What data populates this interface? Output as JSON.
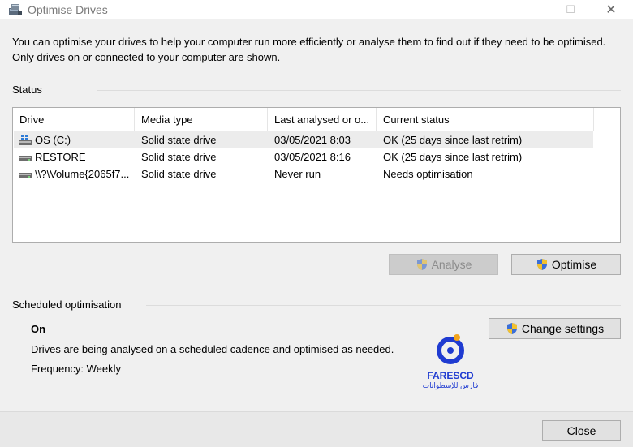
{
  "window": {
    "title": "Optimise Drives",
    "app_icon": "defrag-icon",
    "minimize_glyph": "—",
    "maximize_glyph": "☐",
    "close_glyph": "✕"
  },
  "description": "You can optimise your drives to help your computer run more efficiently or analyse them to find out if they need to be optimised. Only drives on or connected to your computer are shown.",
  "status": {
    "label": "Status",
    "columns": [
      "Drive",
      "Media type",
      "Last analysed or o...",
      "Current status"
    ],
    "rows": [
      {
        "drive": "OS (C:)",
        "icon": "windows-drive-icon",
        "media": "Solid state drive",
        "last": "03/05/2021 8:03",
        "status": "OK (25 days since last retrim)",
        "selected": true
      },
      {
        "drive": "RESTORE",
        "icon": "drive-icon",
        "media": "Solid state drive",
        "last": "03/05/2021 8:16",
        "status": "OK (25 days since last retrim)",
        "selected": false
      },
      {
        "drive": "\\\\?\\Volume{2065f7...",
        "icon": "drive-icon",
        "media": "Solid state drive",
        "last": "Never run",
        "status": "Needs optimisation",
        "selected": false
      }
    ]
  },
  "buttons": {
    "analyse": "Analyse",
    "optimise": "Optimise",
    "change_settings": "Change settings",
    "close": "Close"
  },
  "scheduled": {
    "label": "Scheduled optimisation",
    "state": "On",
    "description": "Drives are being analysed on a scheduled cadence and optimised as needed.",
    "frequency": "Frequency: Weekly"
  },
  "watermark": {
    "name": "FARESCD",
    "subtitle": "فارس للإسطوانات"
  },
  "colors": {
    "accent": "#1f3bd1",
    "selected_row": "#ececec"
  }
}
